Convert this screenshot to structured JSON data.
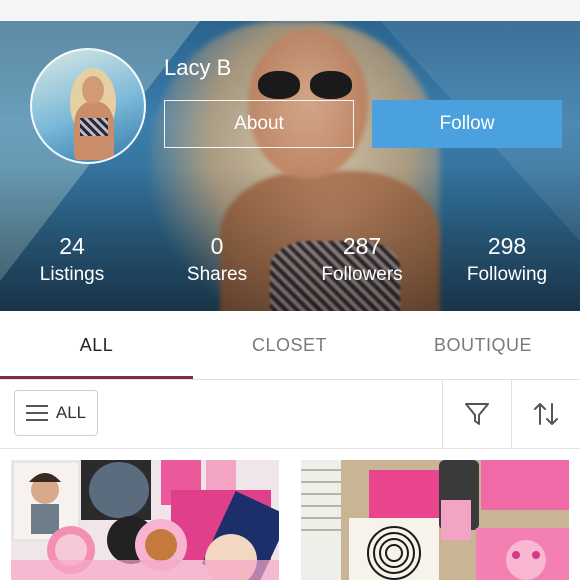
{
  "profile": {
    "username": "Lacy B",
    "about_label": "About",
    "follow_label": "Follow"
  },
  "stats": [
    {
      "value": "24",
      "label": "Listings"
    },
    {
      "value": "0",
      "label": "Shares"
    },
    {
      "value": "287",
      "label": "Followers"
    },
    {
      "value": "298",
      "label": "Following"
    }
  ],
  "tabs": [
    {
      "label": "ALL",
      "active": true
    },
    {
      "label": "CLOSET",
      "active": false
    },
    {
      "label": "BOUTIQUE",
      "active": false
    }
  ],
  "filterbar": {
    "all_label": "ALL",
    "icons": [
      "menu-icon",
      "filter-icon",
      "sort-icon"
    ]
  },
  "colors": {
    "follow_button": "#4aa1dd",
    "active_tab_underline": "#822843"
  }
}
